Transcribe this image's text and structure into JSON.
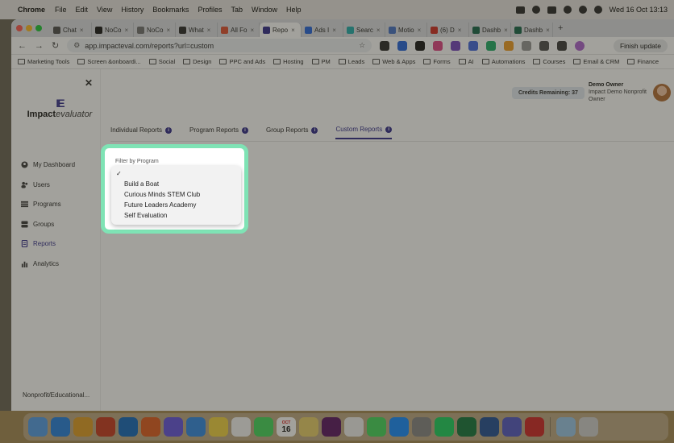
{
  "menubar": {
    "app_name": "Chrome",
    "items": [
      "File",
      "Edit",
      "View",
      "History",
      "Bookmarks",
      "Profiles",
      "Tab",
      "Window",
      "Help"
    ],
    "datetime": "Wed 16 Oct 13:13"
  },
  "browser": {
    "tabs": [
      {
        "label": "Chat",
        "fav_color": "#555555"
      },
      {
        "label": "NoCo",
        "fav_color": "#222222"
      },
      {
        "label": "NoCo",
        "fav_color": "#777777"
      },
      {
        "label": "What",
        "fav_color": "#333333"
      },
      {
        "label": "All Fo",
        "fav_color": "#e0563a"
      },
      {
        "label": "Repo",
        "fav_color": "#3a3590"
      },
      {
        "label": "Ads I",
        "fav_color": "#2d6cdf"
      },
      {
        "label": "Searc",
        "fav_color": "#2ab0b0"
      },
      {
        "label": "Motio",
        "fav_color": "#4d78c8"
      },
      {
        "label": "(6) D",
        "fav_color": "#d0342c"
      },
      {
        "label": "Dashb",
        "fav_color": "#1f6b52"
      },
      {
        "label": "Dashb",
        "fav_color": "#1f6b52"
      }
    ],
    "url": "app.impacteval.com/reports?url=custom",
    "finish_update": "Finish update",
    "bookmarks": [
      "Marketing Tools",
      "Screen &onboardi...",
      "Social",
      "Design",
      "PPC and Ads",
      "Hosting",
      "PM",
      "Leads",
      "Web & Apps",
      "Forms",
      "AI",
      "Automations",
      "Courses",
      "Email & CRM",
      "Finance"
    ]
  },
  "app": {
    "logo_mark": "IE",
    "logo_bold": "Impact",
    "logo_italic": "evaluator",
    "nav": [
      {
        "label": "My Dashboard",
        "icon": "user-circle-icon"
      },
      {
        "label": "Users",
        "icon": "users-icon"
      },
      {
        "label": "Programs",
        "icon": "list-icon"
      },
      {
        "label": "Groups",
        "icon": "layers-icon"
      },
      {
        "label": "Reports",
        "icon": "document-icon"
      },
      {
        "label": "Analytics",
        "icon": "bar-chart-icon"
      }
    ],
    "org_name": "Nonprofit/Educational...",
    "credits": "Credits Remaining: 37",
    "user": {
      "name": "Demo  Owner",
      "org": "Impact Demo Nonprofit",
      "role": "Owner"
    },
    "report_tabs": [
      "Individual Reports",
      "Program Reports",
      "Group Reports",
      "Custom Reports"
    ],
    "active_tab": "Custom Reports",
    "filter_label": "Filter by Program",
    "dropdown": {
      "selected_mark": "✓",
      "options": [
        "Build a Boat",
        "Curious Minds STEM Club",
        "Future Leaders Academy",
        "Self Evaluation"
      ]
    }
  },
  "dock": {
    "calendar_month": "OCT",
    "calendar_day": "16",
    "apps": [
      "Finder",
      "Safari",
      "Chrome",
      "PowerPoint",
      "Outlook",
      "Firefox",
      "Siri",
      "Mail",
      "Notes",
      "Reminders",
      "Messages",
      "Calendar",
      "Stickies",
      "Slack",
      "Photos",
      "Facetime",
      "App Store",
      "Settings",
      "WhatsApp",
      "Excel",
      "Word",
      "Teams",
      "Acrobat",
      "Files",
      "Trash"
    ]
  },
  "colors": {
    "brand": "#3a3590",
    "highlight": "#7fe3b5"
  }
}
